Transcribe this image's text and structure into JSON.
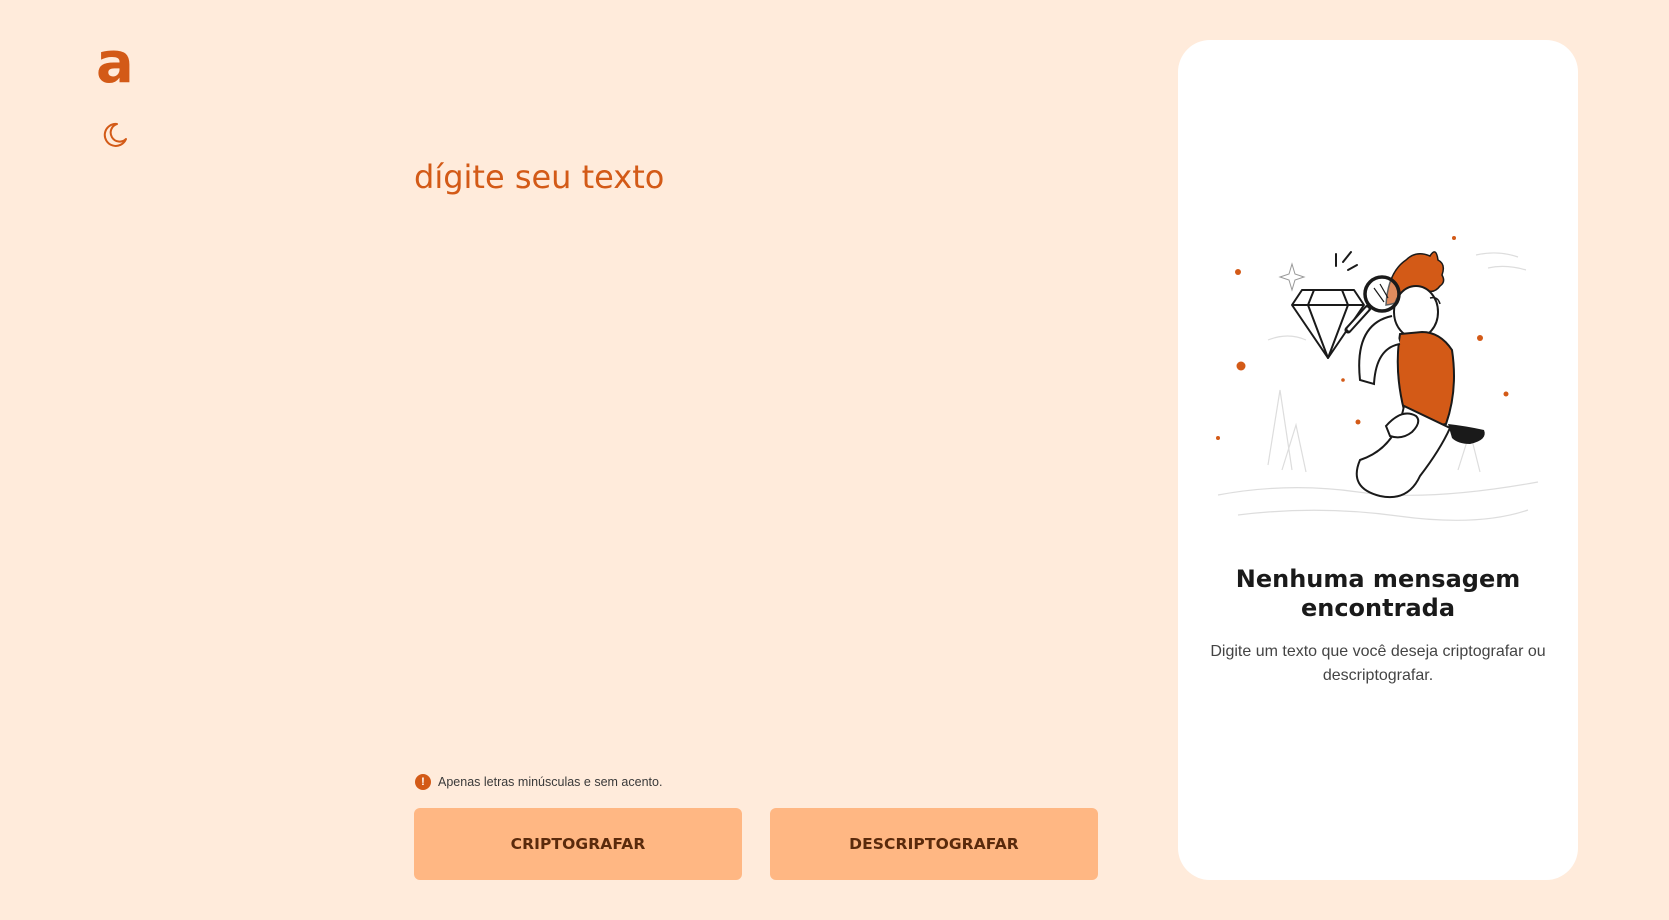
{
  "app": {
    "logo_letter": "a",
    "accent_color": "#d35a17",
    "background_color": "#ffebdb",
    "button_color": "#ffb783"
  },
  "sidebar": {
    "logo_icon": "brand-a-logo",
    "theme_toggle_icon": "moon-icon"
  },
  "input": {
    "placeholder": "dígite seu texto",
    "value": "",
    "hint_icon": "exclamation-icon",
    "hint": "Apenas letras minúsculas e sem acento."
  },
  "actions": {
    "encrypt_label": "CRIPTOGRAFAR",
    "decrypt_label": "DESCRIPTOGRAFAR"
  },
  "output": {
    "illustration_icon": "person-with-magnifier-illustration",
    "empty_title": "Nenhuma mensagem encontrada",
    "empty_text": "Digite um texto que você deseja criptografar ou descriptografar."
  }
}
